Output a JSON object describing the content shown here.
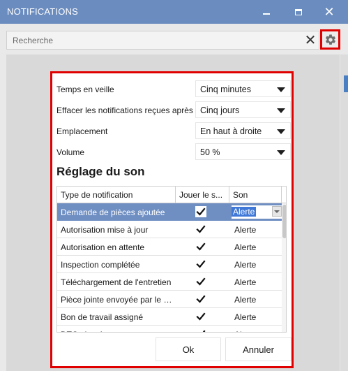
{
  "window": {
    "title": "NOTIFICATIONS",
    "close_glyph": "✕"
  },
  "search": {
    "placeholder": "Recherche",
    "value": "",
    "clear_glyph": "✕",
    "settings_icon": "gear-icon"
  },
  "settings": {
    "rows": [
      {
        "label": "Temps en veille",
        "value": "Cinq minutes"
      },
      {
        "label": "Effacer les notifications reçues après",
        "value": "Cinq jours"
      },
      {
        "label": "Emplacement",
        "value": "En haut à droite"
      },
      {
        "label": "Volume",
        "value": "50 %"
      }
    ]
  },
  "sound": {
    "title": "Réglage du son",
    "columns": [
      "Type de notification",
      "Jouer le s...",
      "Son"
    ],
    "rows": [
      {
        "type": "Demande de pièces ajoutée",
        "play": true,
        "sound": "Alerte",
        "selected": true
      },
      {
        "type": "Autorisation mise à jour",
        "play": true,
        "sound": "Alerte"
      },
      {
        "type": "Autorisation en attente",
        "play": true,
        "sound": "Alerte"
      },
      {
        "type": "Inspection complétée",
        "play": true,
        "sound": "Alerte"
      },
      {
        "type": "Téléchargement de l'entretien",
        "play": true,
        "sound": "Alerte"
      },
      {
        "type": "Pièce jointe envoyée par le technicien",
        "play": true,
        "sound": "Alerte"
      },
      {
        "type": "Bon de travail assigné",
        "play": true,
        "sound": "Alerte"
      },
      {
        "type": "DTC ajouté",
        "play": true,
        "sound": "Alerte"
      }
    ]
  },
  "buttons": {
    "ok": "Ok",
    "cancel": "Annuler"
  },
  "colors": {
    "titlebar": "#6b8cbf",
    "highlight_border": "#e00000",
    "selected_row": "#6f8fc3"
  }
}
